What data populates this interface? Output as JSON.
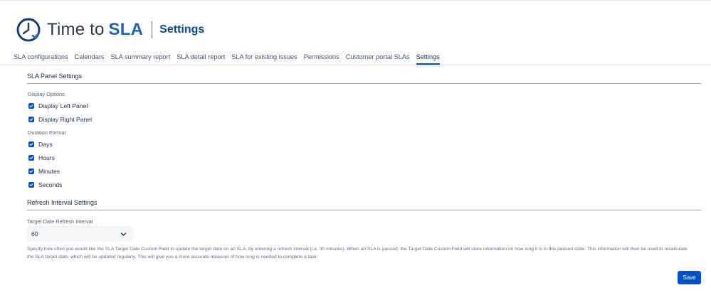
{
  "app": {
    "name_prefix": "Time to",
    "name_accent": "SLA",
    "page_title": "Settings"
  },
  "tabs": [
    {
      "label": "SLA configurations"
    },
    {
      "label": "Calendars"
    },
    {
      "label": "SLA summary report"
    },
    {
      "label": "SLA detail report"
    },
    {
      "label": "SLA for existing issues"
    },
    {
      "label": "Permissions"
    },
    {
      "label": "Customer portal SLAs"
    },
    {
      "label": "Settings",
      "active": true
    }
  ],
  "panel_settings": {
    "title": "SLA Panel Settings",
    "display_options": {
      "label": "Display Options",
      "items": [
        {
          "label": "Display Left Panel",
          "checked": true
        },
        {
          "label": "Display Right Panel",
          "checked": true
        }
      ]
    },
    "duration_format": {
      "label": "Duration Format",
      "items": [
        {
          "label": "Days",
          "checked": true
        },
        {
          "label": "Hours",
          "checked": true
        },
        {
          "label": "Minutes",
          "checked": true
        },
        {
          "label": "Seconds",
          "checked": true
        }
      ]
    }
  },
  "refresh_settings": {
    "title": "Refresh Interval Settings",
    "field_label": "Target Date Refresh Interval",
    "value": "60",
    "help_text": "Specify how often you would like the SLA Target Date Custom Field to update the target date on an SLA, by entering a refresh interval (i.e. 30 minutes). When an SLA is paused, the Target Date Custom Field will store information on how long it is in this paused state. This information will then be used to recalculate the SLA target date, which will be updated regularly. This will give you a more accurate measure of how long is needed to complete a task."
  },
  "actions": {
    "save_label": "Save"
  },
  "icons": {
    "logo": "clock-check-icon",
    "checkbox": "checkmark-icon",
    "select": "chevron-down-icon"
  },
  "colors": {
    "accent": "#0052cc",
    "brand_blue": "#1f63b8",
    "page_title": "#0c4a8f"
  }
}
